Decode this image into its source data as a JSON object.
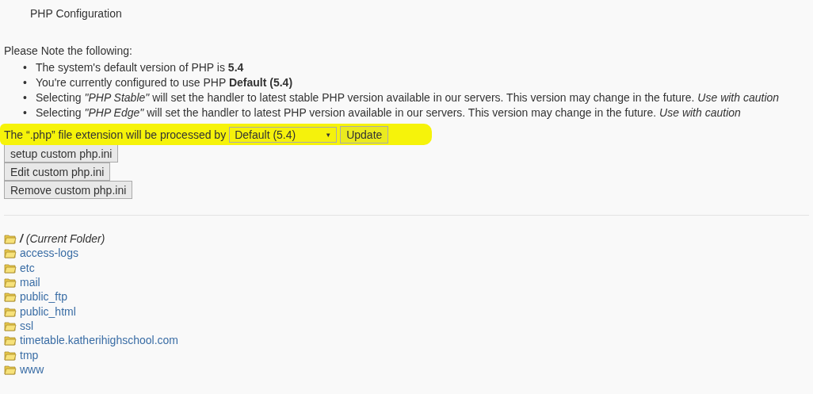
{
  "title": "PHP Configuration",
  "note_heading": "Please Note the following:",
  "bullet": "•",
  "notes": [
    "The system's default version of PHP is **5.4**",
    "You're currently configured to use PHP **Default (5.4)**",
    "Selecting *\"PHP Stable\"* will set the handler to latest stable PHP version available in our servers. This version may change in the future. *Use with caution*",
    "Selecting *\"PHP Edge\"* will set the handler to latest PHP version available in our servers. This version may change in the future. *Use with caution*"
  ],
  "handler": {
    "label": "The “.php” file extension will be processed by",
    "value": "Default (5.4)",
    "caret": "▼",
    "button": "Update",
    "highlighted": true
  },
  "buttons": [
    "setup custom php.ini",
    "Edit custom php.ini",
    "Remove custom php.ini"
  ],
  "folders": [
    {
      "kind": "current",
      "label": "**/** (Current Folder)"
    },
    {
      "kind": "link",
      "label": "access-logs"
    },
    {
      "kind": "link",
      "label": "etc"
    },
    {
      "kind": "link",
      "label": "mail"
    },
    {
      "kind": "link",
      "label": "public_ftp"
    },
    {
      "kind": "link",
      "label": "public_html"
    },
    {
      "kind": "link",
      "label": "ssl"
    },
    {
      "kind": "link",
      "label": "timetable.katherihighschool.com"
    },
    {
      "kind": "link",
      "label": "tmp"
    },
    {
      "kind": "link",
      "label": "www"
    }
  ]
}
